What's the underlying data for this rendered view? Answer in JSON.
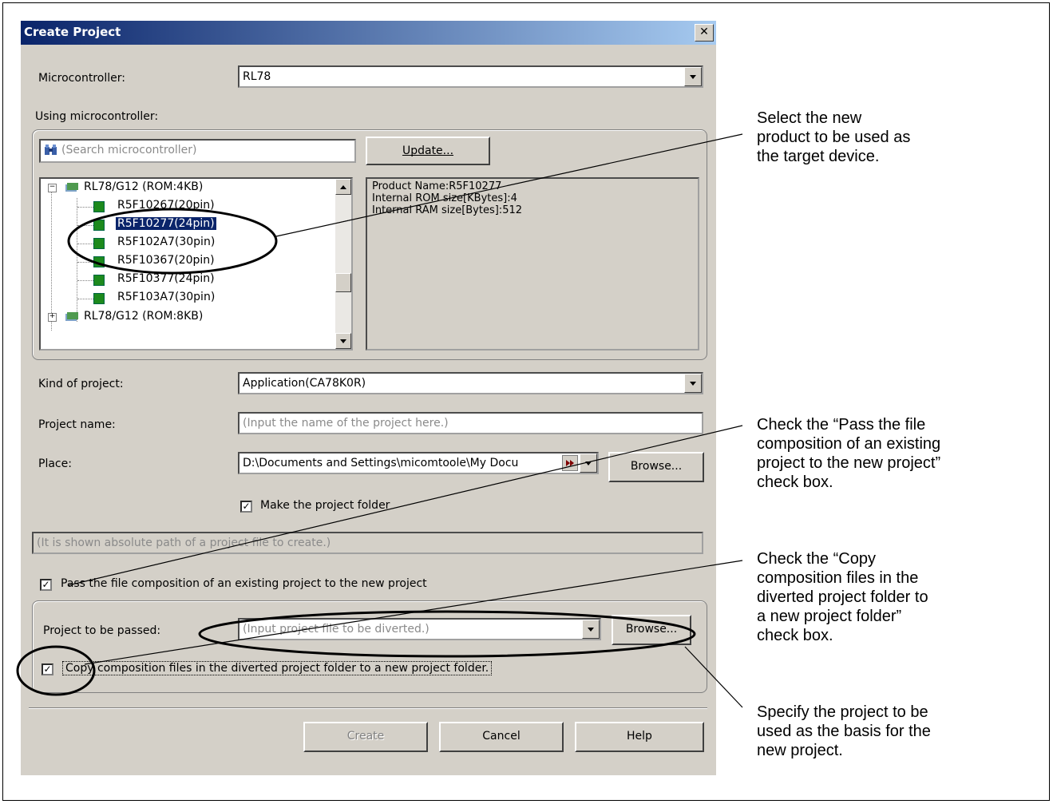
{
  "dialog": {
    "title": "Create Project",
    "close_symbol": "✕",
    "microcontroller_label": "Microcontroller:",
    "microcontroller_value": "RL78",
    "using_label": "Using microcontroller:",
    "search_placeholder": "(Search microcontroller)",
    "update_button": "Update...",
    "tree": [
      {
        "label": "RL78/G12 (ROM:4KB)",
        "type": "group",
        "expanded": true
      },
      {
        "label": "R5F10267(20pin)",
        "type": "device"
      },
      {
        "label": "R5F10277(24pin)",
        "type": "device",
        "selected": true
      },
      {
        "label": "R5F102A7(30pin)",
        "type": "device"
      },
      {
        "label": "R5F10367(20pin)",
        "type": "device"
      },
      {
        "label": "R5F10377(24pin)",
        "type": "device"
      },
      {
        "label": "R5F103A7(30pin)",
        "type": "device"
      },
      {
        "label": "RL78/G12 (ROM:8KB)",
        "type": "group",
        "expanded": false
      }
    ],
    "info_lines": [
      "Product Name:R5F10277",
      "Internal ROM size[KBytes]:4",
      "Internal RAM size[Bytes]:512"
    ],
    "kind_label": "Kind of project:",
    "kind_value": "Application(CA78K0R)",
    "name_label": "Project name:",
    "name_placeholder": "(Input the name of the project here.)",
    "place_label": "Place:",
    "place_value": "D:\\Documents and Settings\\micomtoole\\My Docu",
    "browse_button": "Browse...",
    "make_folder_label": "Make the project folder",
    "make_folder_checked": true,
    "absolute_path_placeholder": "(It is shown absolute path of a project file to create.)",
    "pass_label": "Pass the file composition of an existing project to the new project",
    "pass_checked": true,
    "project_passed_label": "Project to be passed:",
    "project_passed_placeholder": "(Input project file to be diverted.)",
    "browse2_button": "Browse...",
    "copy_label": "Copy composition files in the diverted project folder to a new project folder.",
    "copy_checked": true,
    "create_button": "Create",
    "cancel_button": "Cancel",
    "help_button": "Help"
  },
  "annotations": {
    "select_product": [
      "Select the new",
      "product to be used as",
      "the target device."
    ],
    "check_pass": [
      "Check the “Pass the file",
      "composition of an existing",
      "project to the new project”",
      "check box."
    ],
    "check_copy": [
      "Check the “Copy",
      "composition files in the",
      "diverted project folder to",
      "a new project folder”",
      "check box."
    ],
    "specify_project": [
      "Specify the project to be",
      "used as the basis for the",
      "new project."
    ]
  },
  "colors": {
    "title_start": "#0a246a",
    "title_end": "#a6caf0",
    "dialog_bg": "#d4d0c8",
    "selection": "#0a246a",
    "chip": "#1d8a1d"
  }
}
